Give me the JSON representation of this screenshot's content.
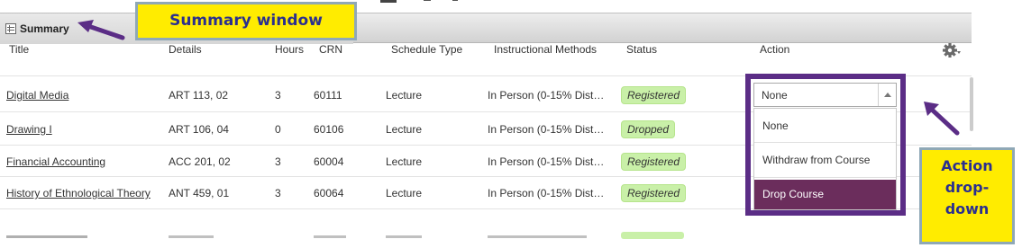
{
  "header": {
    "summary_label": "Summary"
  },
  "columns": [
    "Title",
    "Details",
    "Hours",
    "CRN",
    "Schedule Type",
    "Instructional Methods",
    "Status",
    "Action"
  ],
  "rows": [
    {
      "title": "Digital Media",
      "details": "ART 113, 02",
      "hours": "3",
      "crn": "60111",
      "schedule_type": "Lecture",
      "method": "In Person (0-15% Dist…",
      "status": "Registered"
    },
    {
      "title": "Drawing I",
      "details": "ART 106, 04",
      "hours": "0",
      "crn": "60106",
      "schedule_type": "Lecture",
      "method": "In Person (0-15% Dist…",
      "status": "Dropped"
    },
    {
      "title": "Financial Accounting",
      "details": "ACC 201, 02",
      "hours": "3",
      "crn": "60004",
      "schedule_type": "Lecture",
      "method": "In Person (0-15% Dist…",
      "status": "Registered"
    },
    {
      "title": "History of Ethnological Theory",
      "details": "ANT 459, 01",
      "hours": "3",
      "crn": "60064",
      "schedule_type": "Lecture",
      "method": "In Person (0-15% Dist…",
      "status": "Registered"
    }
  ],
  "action_dropdown": {
    "selected": "None",
    "options": [
      "None",
      "Withdraw from Course",
      "Drop Course"
    ],
    "highlighted_option": "Drop Course"
  },
  "callouts": {
    "summary_window": "Summary window",
    "action_dropdown_lines": [
      "Action",
      "drop-",
      "down"
    ]
  },
  "icons": {
    "summary": "table-icon",
    "settings": "gear-icon",
    "dropdown_arrow": "caret-up-icon"
  },
  "colors": {
    "registered_badge": "#c9f0a8",
    "dropdown_highlight": "#6b2d5c",
    "highlight_box": "#5b2d86",
    "callout_bg": "#ffec00",
    "callout_text": "#2b2f8f"
  }
}
